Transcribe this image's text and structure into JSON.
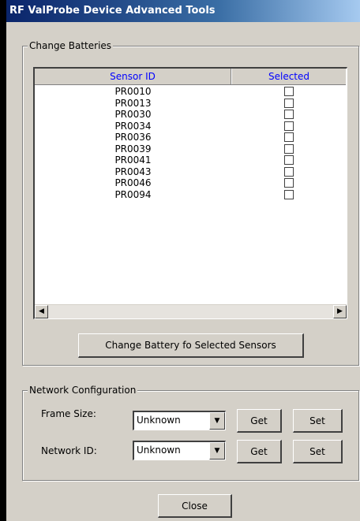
{
  "window": {
    "title": "RF ValProbe Device Advanced Tools"
  },
  "change_batteries": {
    "legend": "Change Batteries",
    "columns": [
      "Sensor ID",
      "Selected"
    ],
    "sensors": [
      {
        "id": "PR0010",
        "selected": false
      },
      {
        "id": "PR0013",
        "selected": false
      },
      {
        "id": "PR0030",
        "selected": false
      },
      {
        "id": "PR0034",
        "selected": false
      },
      {
        "id": "PR0036",
        "selected": false
      },
      {
        "id": "PR0039",
        "selected": false
      },
      {
        "id": "PR0041",
        "selected": false
      },
      {
        "id": "PR0043",
        "selected": false
      },
      {
        "id": "PR0046",
        "selected": false
      },
      {
        "id": "PR0094",
        "selected": false
      }
    ],
    "button_label": "Change Battery fo Selected Sensors"
  },
  "network_config": {
    "legend": "Network Configuration",
    "frame_size": {
      "label": "Frame Size:",
      "value": "Unknown",
      "get_label": "Get",
      "set_label": "Set"
    },
    "network_id": {
      "label": "Network ID:",
      "value": "Unknown",
      "get_label": "Get",
      "set_label": "Set"
    }
  },
  "footer": {
    "close_label": "Close"
  },
  "icons": {
    "dropdown": "chevron-down-icon",
    "scroll_left": "scroll-left-arrow-icon",
    "scroll_right": "scroll-right-arrow-icon"
  }
}
